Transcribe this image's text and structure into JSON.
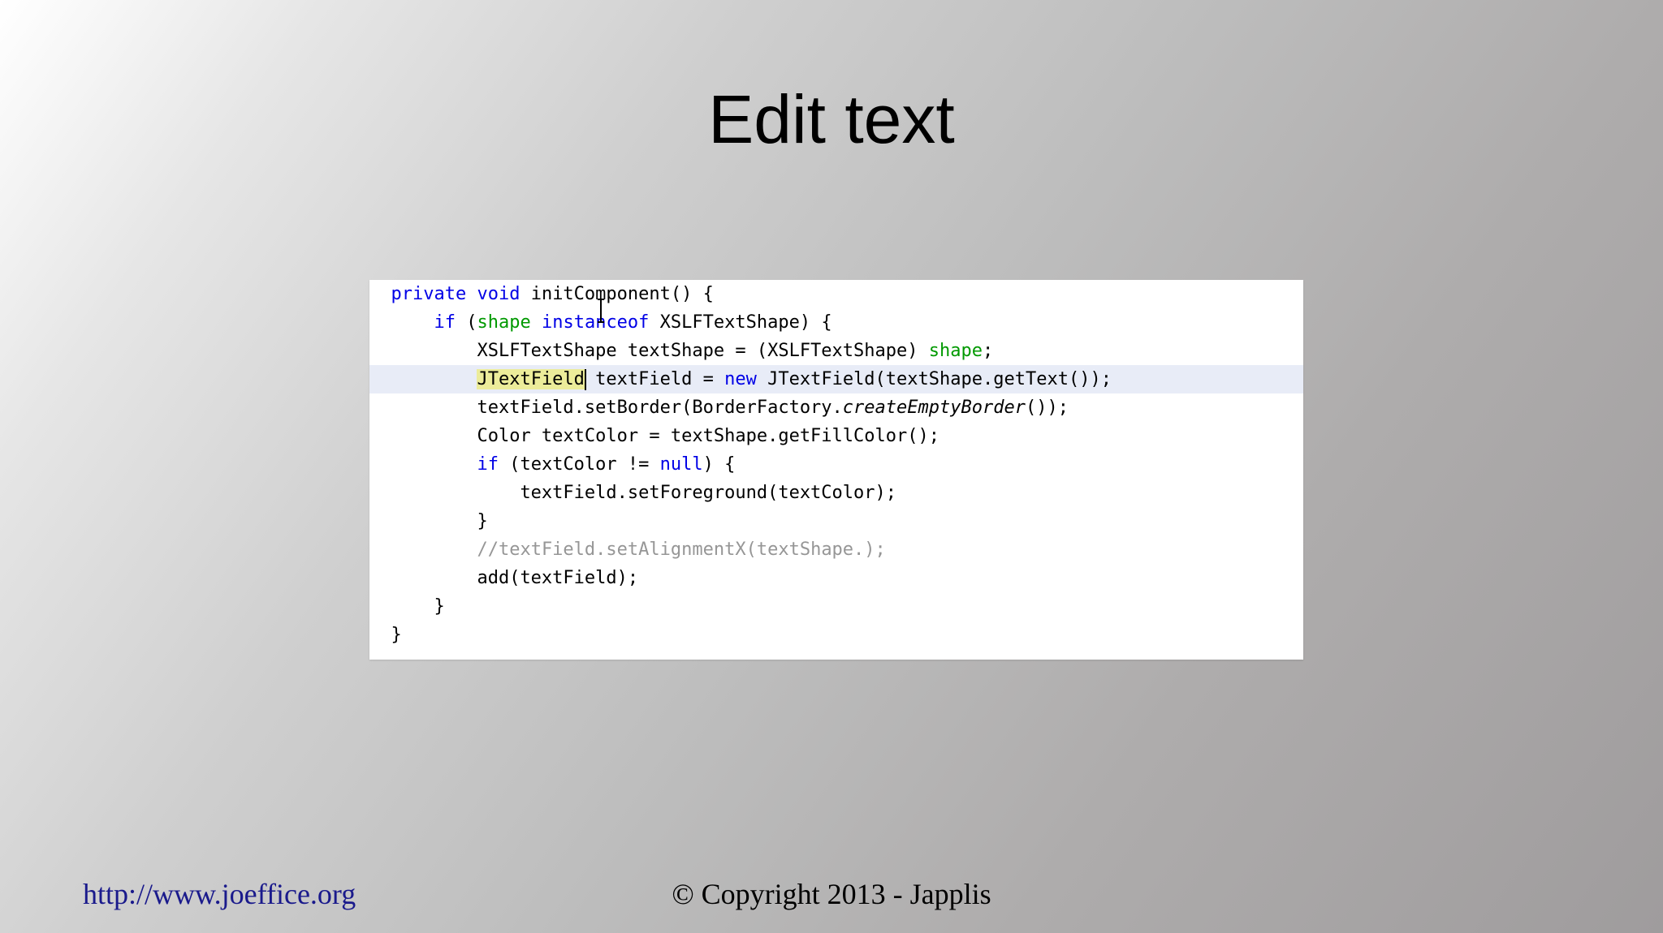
{
  "slide": {
    "title": "Edit text"
  },
  "code": {
    "lines": [
      [
        "private",
        " ",
        "void",
        " initComponent() {"
      ],
      [
        "    ",
        "if",
        " (",
        "shape",
        " ",
        "instanceof",
        " XSLFTextShape) {"
      ],
      [
        "        XSLFTextShape textShape = (XSLFTextShape) ",
        "shape",
        ";"
      ],
      [
        "        ",
        "JTextField",
        " textField = ",
        "new",
        " JTextField(textShape.getText());"
      ],
      [
        "        textField.setBorder(BorderFactory.",
        "createEmptyBorder",
        "());"
      ],
      [
        "        Color textColor = textShape.getFillColor();"
      ],
      [
        "        ",
        "if",
        " (textColor != ",
        "null",
        ") {"
      ],
      [
        "            textField.setForeground(textColor);"
      ],
      [
        "        }"
      ],
      [
        "        ",
        "//textField.setAlignmentX(textShape.);"
      ],
      [
        "        add(textField);"
      ],
      [
        "    }"
      ],
      [
        "}"
      ]
    ]
  },
  "footer": {
    "url": "http://www.joeffice.org",
    "copyright": "© Copyright 2013 - Japplis"
  },
  "colors": {
    "keyword": "#0000e6",
    "field": "#009900",
    "comment": "#969696",
    "highlight": "#ecec9a",
    "current_line": "#e8ecf7",
    "link": "#1a1a8c"
  }
}
